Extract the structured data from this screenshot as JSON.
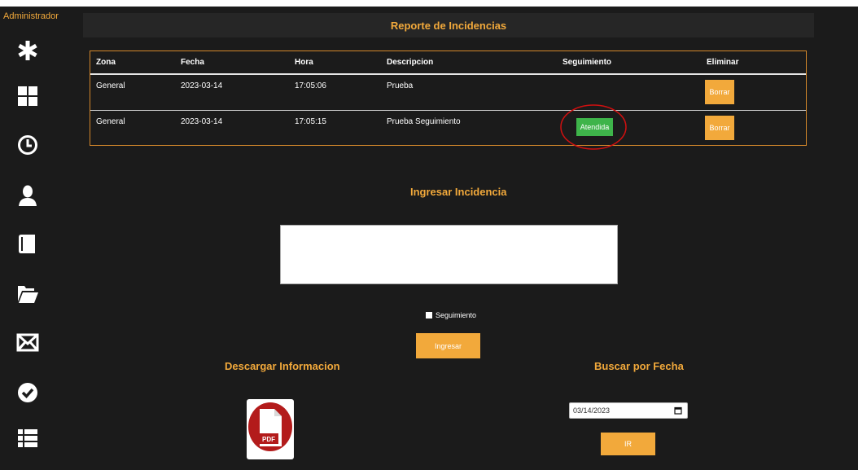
{
  "sidebar": {
    "admin_label": "Administrador",
    "icons": [
      "asterisk-icon",
      "dashboard-grid-icon",
      "clock-icon",
      "user-icon",
      "book-icon",
      "folder-open-icon",
      "envelope-icon",
      "check-circle-icon",
      "list-icon"
    ]
  },
  "header": {
    "title": "Reporte de Incidencias"
  },
  "table": {
    "columns": [
      "Zona",
      "Fecha",
      "Hora",
      "Descripcion",
      "Seguimiento",
      "Eliminar"
    ],
    "rows": [
      {
        "zona": "General",
        "fecha": "2023-03-14",
        "hora": "17:05:06",
        "descripcion": "Prueba",
        "seguimiento": "",
        "eliminar": "Borrar"
      },
      {
        "zona": "General",
        "fecha": "2023-03-14",
        "hora": "17:05:15",
        "descripcion": "Prueba Seguimiento",
        "seguimiento": "Atendida",
        "eliminar": "Borrar"
      }
    ]
  },
  "form": {
    "title": "Ingresar Incidencia",
    "textarea_value": "",
    "checkbox_label": "Seguimiento",
    "submit_label": "Ingresar"
  },
  "download": {
    "title": "Descargar Informacion",
    "pdf_label": "PDF"
  },
  "search": {
    "title": "Buscar por Fecha",
    "date_value": "03/14/2023",
    "button_label": "IR"
  },
  "colors": {
    "accent": "#f2a93b",
    "background": "#1b1b1b",
    "success": "#3eb44a",
    "annotation": "#d01010"
  }
}
